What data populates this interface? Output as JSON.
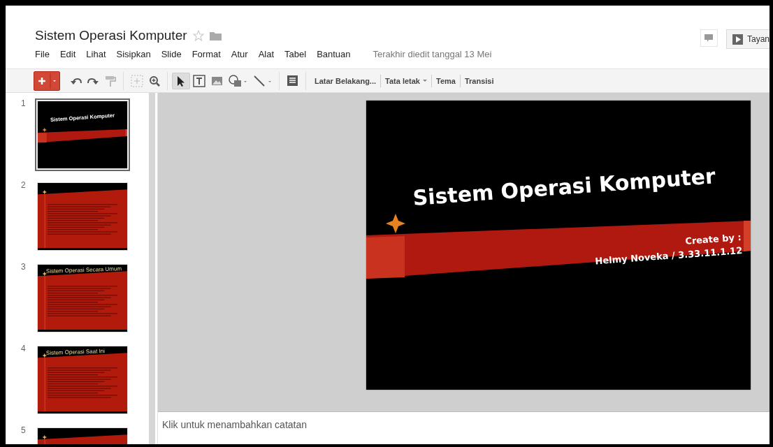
{
  "document": {
    "title": "Sistem Operasi Komputer",
    "starred": false
  },
  "menu": [
    "File",
    "Edit",
    "Lihat",
    "Sisipkan",
    "Slide",
    "Format",
    "Atur",
    "Alat",
    "Tabel",
    "Bantuan"
  ],
  "last_edit": "Terakhir diedit tanggal 13 Mei",
  "present_button": "Tayan",
  "toolbar": {
    "tools": [
      {
        "selected": true
      },
      {
        "selected": false
      },
      {
        "selected": false
      },
      {
        "selected": false
      },
      {
        "selected": false
      }
    ],
    "text_buttons": [
      {
        "label": "Latar Belakang...",
        "dropdown": false
      },
      {
        "label": "Tata letak",
        "dropdown": true
      },
      {
        "label": "Tema",
        "dropdown": false
      },
      {
        "label": "Transisi",
        "dropdown": false
      }
    ]
  },
  "slides": [
    {
      "number": "1",
      "selected": true,
      "kind": "title",
      "title": "Sistem Operasi Komputer"
    },
    {
      "number": "2",
      "selected": false,
      "kind": "content"
    },
    {
      "number": "3",
      "selected": false,
      "kind": "content",
      "title": "Sistem Operasi Secara Umum"
    },
    {
      "number": "4",
      "selected": false,
      "kind": "content",
      "title": "Sistem Operasi Saat Ini"
    },
    {
      "number": "5",
      "selected": false,
      "kind": "content"
    }
  ],
  "current_slide": {
    "title": "Sistem Operasi Komputer",
    "subtitle_label": "Create by :",
    "author_line": "Helmy Noveka /  3.33.11.1.12"
  },
  "notes": {
    "placeholder": "Klik untuk menambahkan catatan"
  }
}
